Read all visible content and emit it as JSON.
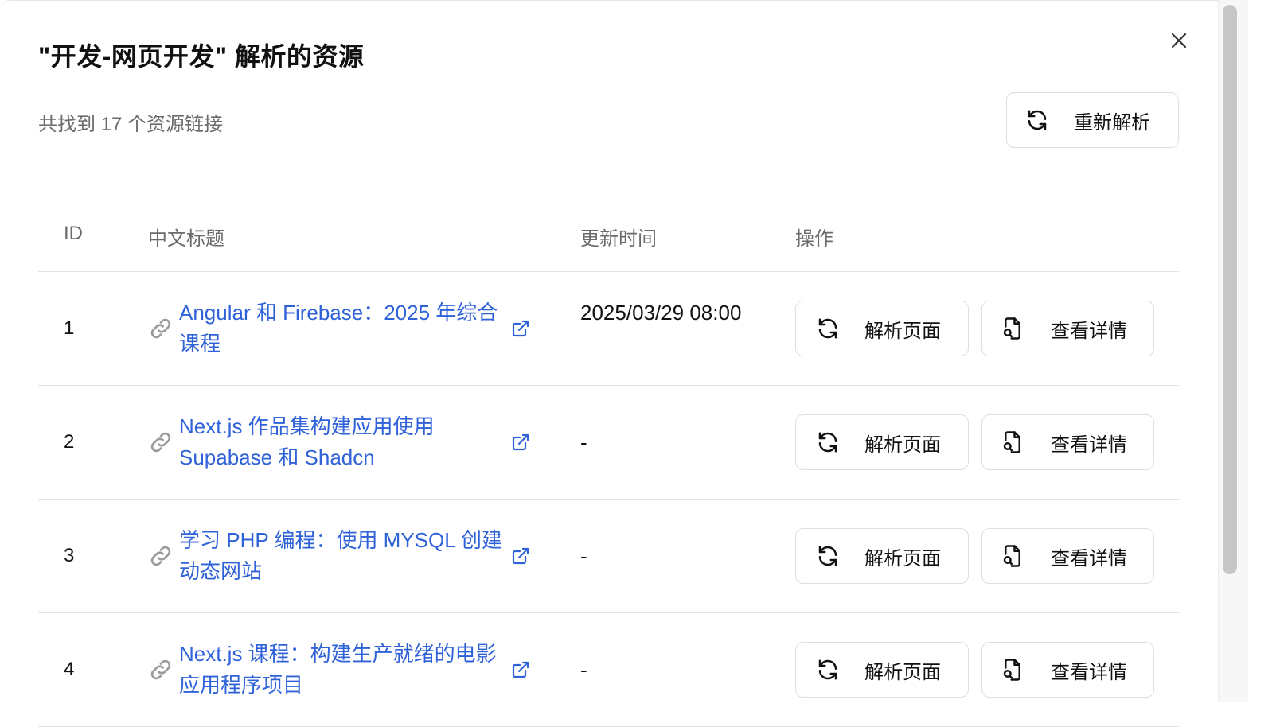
{
  "dialog": {
    "title": "\"开发-网页开发\" 解析的资源",
    "subtitle": "共找到 17 个资源链接",
    "reparse_label": "重新解析"
  },
  "table": {
    "headers": {
      "id": "ID",
      "title": "中文标题",
      "time": "更新时间",
      "actions": "操作"
    },
    "rows": [
      {
        "id": "1",
        "title": "Angular 和 Firebase：2025 年综合课程",
        "time": "2025/03/29 08:00",
        "parse_label": "解析页面",
        "detail_label": "查看详情"
      },
      {
        "id": "2",
        "title": "Next.js 作品集构建应用使用 Supabase 和 Shadcn",
        "time": "-",
        "parse_label": "解析页面",
        "detail_label": "查看详情"
      },
      {
        "id": "3",
        "title": "学习 PHP 编程：使用 MYSQL 创建动态网站",
        "time": "-",
        "parse_label": "解析页面",
        "detail_label": "查看详情"
      },
      {
        "id": "4",
        "title": "Next.js 课程：构建生产就绪的电影应用程序项目",
        "time": "-",
        "parse_label": "解析页面",
        "detail_label": "查看详情"
      }
    ]
  },
  "colors": {
    "link": "#2f62d9",
    "muted": "#6b6b6b",
    "border": "#e3e3e3"
  },
  "icons": {
    "close": "close-icon",
    "refresh": "refresh-icon",
    "link": "link-icon",
    "external": "external-link-icon",
    "file_search": "file-search-icon"
  }
}
